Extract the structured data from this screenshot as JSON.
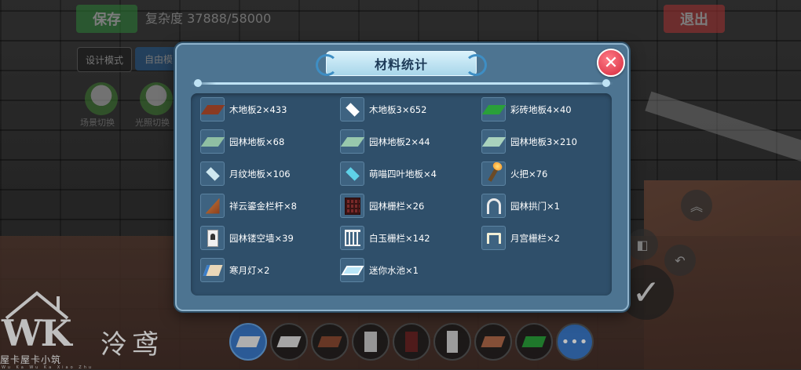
{
  "top": {
    "save_label": "保存",
    "complexity": "复杂度 37888/58000",
    "exit_label": "退出"
  },
  "modes": {
    "design": "设计模式",
    "free": "自由模"
  },
  "circles": {
    "c1": "场景切换",
    "c2": "光照切换"
  },
  "modal": {
    "title": "材料统计",
    "close_icon": "close-icon",
    "items": [
      {
        "label": "木地板2×433",
        "icon": "wood-floor-icon",
        "color": "#8a3a22"
      },
      {
        "label": "木地板3×652",
        "icon": "white-floor-icon",
        "color": "#ffffff"
      },
      {
        "label": "彩砖地板4×40",
        "icon": "green-tile-icon",
        "color": "#2aa03a"
      },
      {
        "label": "园林地板×68",
        "icon": "garden-floor-icon",
        "color": "#8fbfa3"
      },
      {
        "label": "园林地板2×44",
        "icon": "garden-floor-icon",
        "color": "#98c8ad"
      },
      {
        "label": "园林地板3×210",
        "icon": "garden-floor-icon",
        "color": "#a9d2bd"
      },
      {
        "label": "月纹地板×106",
        "icon": "moon-floor-icon",
        "color": "#cfe8f0"
      },
      {
        "label": "萌喵四叶地板×4",
        "icon": "clover-floor-icon",
        "color": "#5fd1e8"
      },
      {
        "label": "火把×76",
        "icon": "torch-icon",
        "color": "#ff9a2a"
      },
      {
        "label": "祥云鎏金栏杆×8",
        "icon": "gold-railing-icon",
        "color": "#c77a3a"
      },
      {
        "label": "园林栅栏×26",
        "icon": "fence-icon",
        "color": "#7a2a2a"
      },
      {
        "label": "园林拱门×1",
        "icon": "arch-icon",
        "color": "#e9e9e9"
      },
      {
        "label": "园林镂空墙×39",
        "icon": "hollow-wall-icon",
        "color": "#f0f0f0"
      },
      {
        "label": "白玉栅栏×142",
        "icon": "jade-railing-icon",
        "color": "#f2f2f2"
      },
      {
        "label": "月宫栅栏×2",
        "icon": "moon-gate-icon",
        "color": "#f2efd6"
      },
      {
        "label": "寒月灯×2",
        "icon": "lamp-icon",
        "color": "#e9d7b8"
      },
      {
        "label": "迷你水池×1",
        "icon": "pool-icon",
        "color": "#b9e5f7"
      }
    ]
  },
  "hotbar": [
    {
      "icon": "eraser-icon",
      "color": "#e8e8e8",
      "selected": true
    },
    {
      "icon": "white-floor-icon",
      "color": "#dcdcdc"
    },
    {
      "icon": "wood-floor-icon",
      "color": "#8a4a32"
    },
    {
      "icon": "door-icon",
      "color": "#c9c9c9"
    },
    {
      "icon": "fence-icon",
      "color": "#6a2424"
    },
    {
      "icon": "wall-icon",
      "color": "#d0d0d0"
    },
    {
      "icon": "tile-icon",
      "color": "#b06a4a"
    },
    {
      "icon": "green-tile-icon",
      "color": "#2aa03a"
    },
    {
      "icon": "more-icon",
      "label": "•••"
    }
  ],
  "watermark": {
    "letters": "WK",
    "name": "泠鸢",
    "sub": "屋卡屋卡小筑",
    "tiny": "Wu Ka Wu Ka Xiao Zhu"
  }
}
